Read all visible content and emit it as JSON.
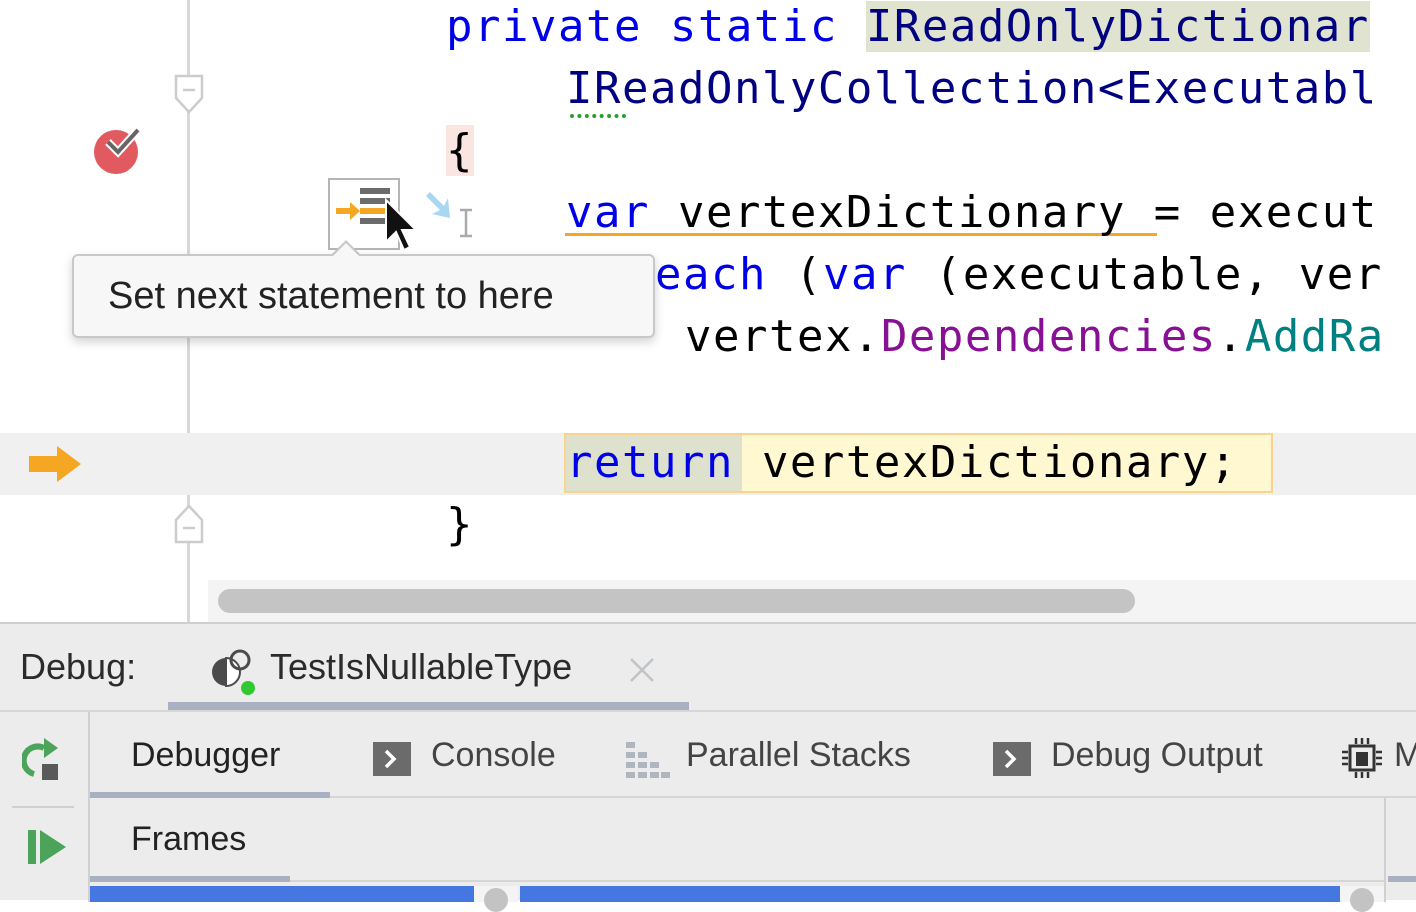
{
  "editor": {
    "lines": [
      {
        "parts": [
          {
            "t": "private static ",
            "c": "kw"
          },
          {
            "t": "IReadOnlyDictionar",
            "c": "ty hl-type"
          }
        ]
      },
      {
        "parts": [
          {
            "t": "IReadOnlyCollection<Executabl",
            "c": "ty"
          }
        ]
      },
      {
        "parts": [
          {
            "t": "{",
            "c": "brace-hl"
          }
        ]
      },
      {
        "parts": [
          {
            "t": "var",
            "c": "kw"
          },
          {
            "t": " vertexDictionary = execut",
            "c": ""
          }
        ]
      },
      {
        "parts": [
          {
            "t": "each",
            "c": "kw"
          },
          {
            "t": " (",
            "c": ""
          },
          {
            "t": "var",
            "c": "kw"
          },
          {
            "t": " (executable, ver",
            "c": ""
          }
        ]
      },
      {
        "parts": [
          {
            "t": "vertex.",
            "c": ""
          },
          {
            "t": "Dependencies",
            "c": "pu"
          },
          {
            "t": ".",
            "c": ""
          },
          {
            "t": "AddRa",
            "c": "me"
          }
        ]
      },
      {
        "parts": []
      },
      {
        "parts": [
          {
            "t": "return",
            "c": "kw"
          },
          {
            "t": " vertexDictionary;",
            "c": ""
          }
        ]
      },
      {
        "parts": [
          {
            "t": "}",
            "c": ""
          }
        ]
      }
    ],
    "execution_point_line": 8,
    "gutter_icons": {
      "breakpoint": "breakpoint-checked-icon",
      "execution_arrow": "execution-pointer-icon",
      "set_next_statement": "set-next-statement-icon",
      "run_to_cursor": "run-to-cursor-icon"
    }
  },
  "tooltip": {
    "text": "Set next statement to here"
  },
  "debug_panel": {
    "label": "Debug:",
    "session": {
      "name": "TestIsNullableType",
      "icon": "debug-session-icon",
      "close_icon": "close-icon"
    },
    "toolbar": [
      {
        "name": "rerun",
        "icon": "rerun-icon"
      },
      {
        "name": "resume",
        "icon": "resume-icon"
      }
    ],
    "tabs": [
      {
        "label": "Debugger",
        "icon": "",
        "active": true
      },
      {
        "label": "Console",
        "icon": "console-icon",
        "active": false
      },
      {
        "label": "Parallel Stacks",
        "icon": "parallel-stacks-icon",
        "active": false
      },
      {
        "label": "Debug Output",
        "icon": "console-icon",
        "active": false
      },
      {
        "label": "M",
        "icon": "memory-icon",
        "active": false
      }
    ],
    "frames_label": "Frames"
  },
  "colors": {
    "keyword": "#0000e6",
    "type": "#000080",
    "property": "#871094",
    "method": "#008080",
    "execution_arrow": "#f5a623",
    "breakpoint": "#e05a5f",
    "selection": "#4577e0",
    "accent_green": "#4ca35a"
  }
}
